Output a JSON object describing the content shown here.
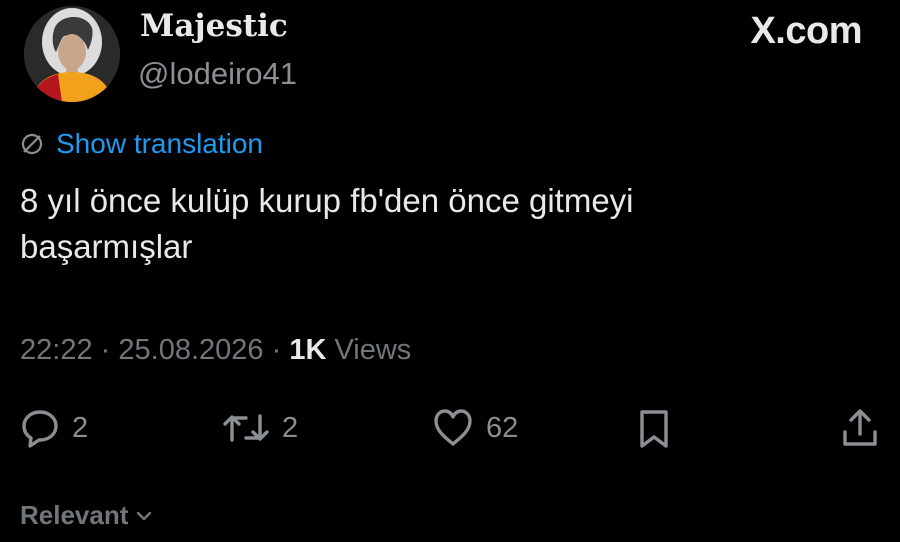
{
  "author": {
    "display_name": "Majestic",
    "handle": "@lodeiro41",
    "avatar_icon": "profile-photo"
  },
  "brand": "X.com",
  "translation": {
    "label": "Show translation",
    "icon": "globe-icon",
    "color": "#1d9bf0"
  },
  "tweet": {
    "lines": [
      "8 yıl önce kulüp kurup fb'den önce gitmeyi",
      "başarmışlar"
    ]
  },
  "meta": {
    "time": "22:22",
    "date": "25.08.2026",
    "separator": "·",
    "views_count": "1K",
    "views_label": "Views"
  },
  "actions": {
    "reply_count": "2",
    "retweet_count": "2",
    "like_count": "62"
  },
  "filter": {
    "label": "Relevant"
  }
}
